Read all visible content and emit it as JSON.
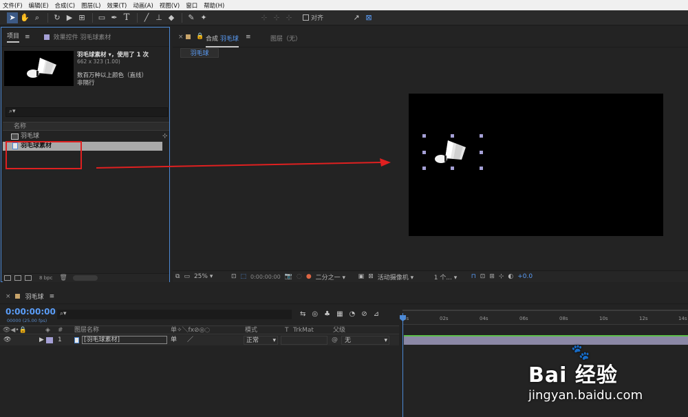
{
  "menu": [
    "文件(F)",
    "编辑(E)",
    "合成(C)",
    "图层(L)",
    "效果(T)",
    "动画(A)",
    "视图(V)",
    "窗口",
    "帮助(H)"
  ],
  "toolbar": {
    "align_label": "对齐"
  },
  "project": {
    "tab_label": "项目",
    "effects_tab": "效果控件 羽毛球素材",
    "asset_name": "羽毛球素材 ▾，使用了 1 次",
    "asset_dims": "662 x 323 (1.00)",
    "asset_color": "数百万种以上颜色（直线）",
    "asset_interlace": "非隔行",
    "column_name": "名称",
    "items": [
      {
        "label": "羽毛球",
        "selected": false
      },
      {
        "label": "羽毛球素材",
        "selected": true
      }
    ],
    "bpc": "8 bpc"
  },
  "comp": {
    "tab_prefix": "合成",
    "tab_name": "羽毛球",
    "layer_tab": "图层（无）",
    "subtab": "羽毛球",
    "zoom": "25%",
    "timecode": "0:00:00:00",
    "resolution": "二分之一",
    "camera": "活动摄像机",
    "views": "1 个...",
    "exposure": "+0.0"
  },
  "timeline": {
    "comp_name": "羽毛球",
    "timecode": "0:00:00:00",
    "fps": "00000 (25.00 fps)",
    "headers": {
      "num": "#",
      "layer_name": "图层名称",
      "mode": "模式",
      "t": "T",
      "trkmat": "TrkMat",
      "parent": "父级"
    },
    "layer": {
      "index": "1",
      "name": "[羽毛球素材]",
      "mode": "正常",
      "parent": "无"
    },
    "ticks": [
      "0s",
      "02s",
      "04s",
      "06s",
      "08s",
      "10s",
      "12s",
      "14s"
    ]
  },
  "watermark": {
    "logo": "Bai 经验",
    "url": "jingyan.baidu.com"
  },
  "colors": {
    "accent": "#4d8ad6",
    "timecode": "#5a9df8",
    "highlight": "#e02020",
    "layer_label": "#a5a0d6"
  }
}
